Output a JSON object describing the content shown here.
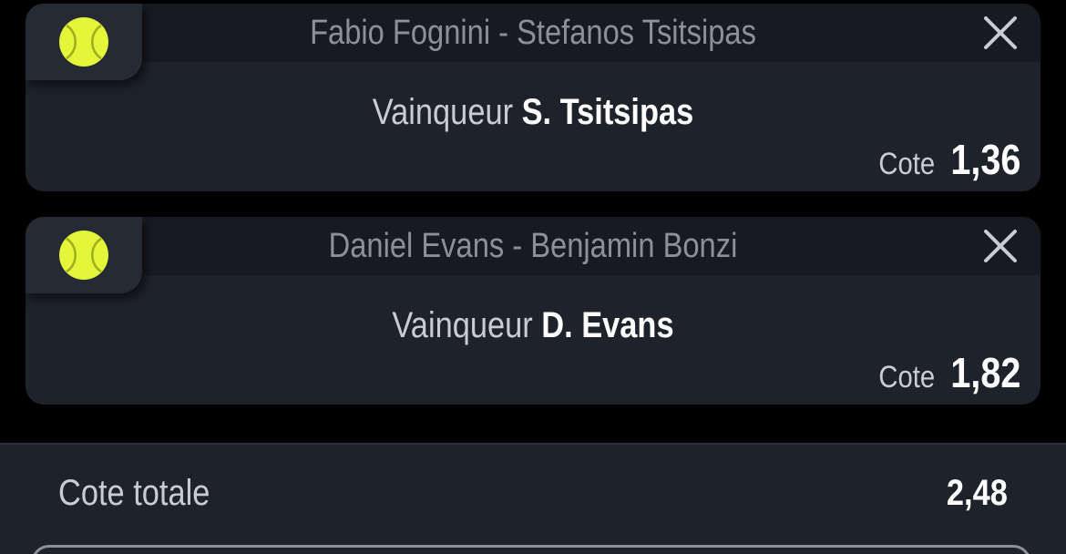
{
  "bets": [
    {
      "sport_icon": "tennis-ball-icon",
      "match": "Fabio Fognini - Stefanos Tsitsipas",
      "market": "Vainqueur",
      "pick": "S. Tsitsipas",
      "odds_label": "Cote",
      "odds": "1,36"
    },
    {
      "sport_icon": "tennis-ball-icon",
      "match": "Daniel Evans - Benjamin Bonzi",
      "market": "Vainqueur",
      "pick": "D. Evans",
      "odds_label": "Cote",
      "odds": "1,82"
    }
  ],
  "summary": {
    "total_label": "Cote totale",
    "total_value": "2,48"
  },
  "colors": {
    "background": "#000000",
    "card": "#1e222b",
    "card_header": "#171a21",
    "ball": "#e4f53a",
    "muted_text": "#8d9099",
    "text": "#ffffff"
  }
}
